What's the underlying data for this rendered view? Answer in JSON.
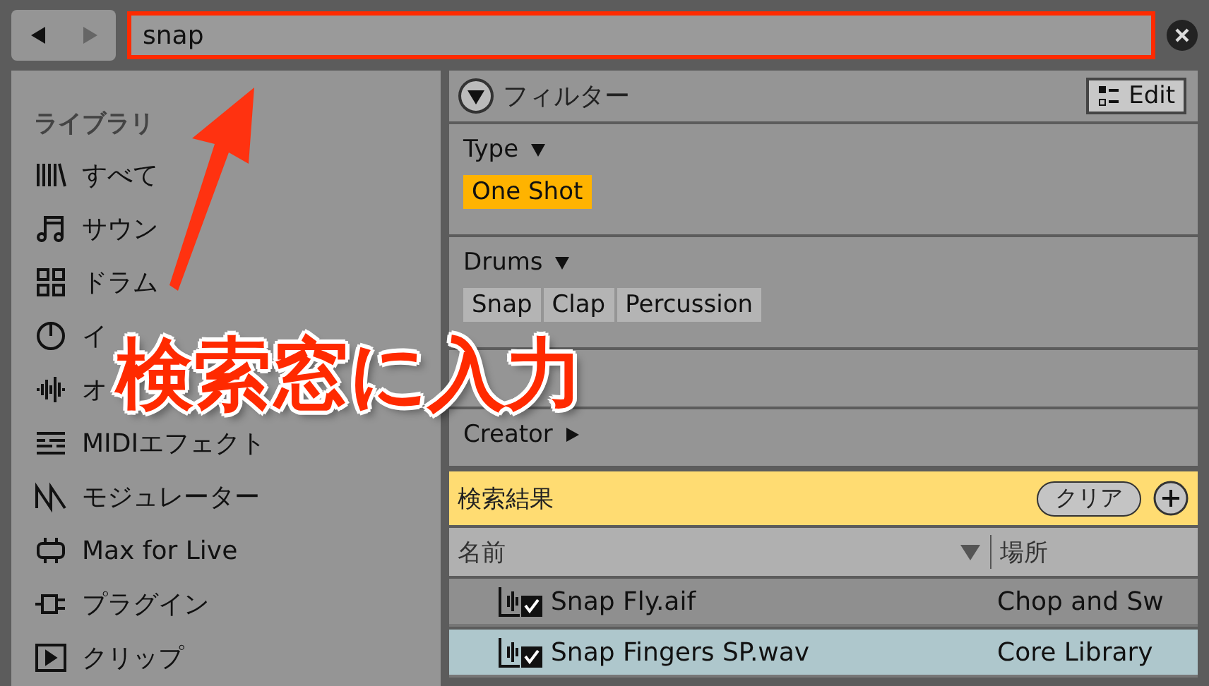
{
  "search": {
    "value": "snap",
    "highlighted": true
  },
  "sidebar": {
    "title": "ライブラリ",
    "items": [
      {
        "label": "すべて",
        "kind": "all"
      },
      {
        "label": "サウン",
        "kind": "note"
      },
      {
        "label": "ドラム",
        "kind": "grid"
      },
      {
        "label": "イ",
        "kind": "dial"
      },
      {
        "label": "オ",
        "kind": "wave"
      },
      {
        "label": "MIDIエフェクト",
        "kind": "midi"
      },
      {
        "label": "モジュレーター",
        "kind": "mod"
      },
      {
        "label": "Max for Live",
        "kind": "max"
      },
      {
        "label": "プラグイン",
        "kind": "plug"
      },
      {
        "label": "クリップ",
        "kind": "clip"
      }
    ]
  },
  "filter": {
    "title": "フィルター",
    "edit": "Edit",
    "expanded": true,
    "groups": [
      {
        "kind": "tags",
        "label": "Type",
        "expanded": true,
        "tags": [
          {
            "label": "One Shot",
            "selected": true
          }
        ]
      },
      {
        "kind": "tags",
        "label": "Drums",
        "expanded": true,
        "tags": [
          {
            "label": "Snap",
            "selected": false
          },
          {
            "label": "Clap",
            "selected": false
          },
          {
            "label": "Percussion",
            "selected": false
          }
        ]
      },
      {
        "kind": "covered"
      },
      {
        "kind": "tags",
        "label": "Creator",
        "expanded": false
      }
    ]
  },
  "results": {
    "title": "検索結果",
    "clear": "クリア",
    "columns": [
      "名前",
      "場所"
    ],
    "rows": [
      {
        "name": "Snap Fly.aif",
        "place": "Chop and Sw",
        "selected": false
      },
      {
        "name": "Snap Fingers SP.wav",
        "place": "Core Library",
        "selected": true
      }
    ]
  },
  "annotation": {
    "text": "検索窓に入力"
  }
}
